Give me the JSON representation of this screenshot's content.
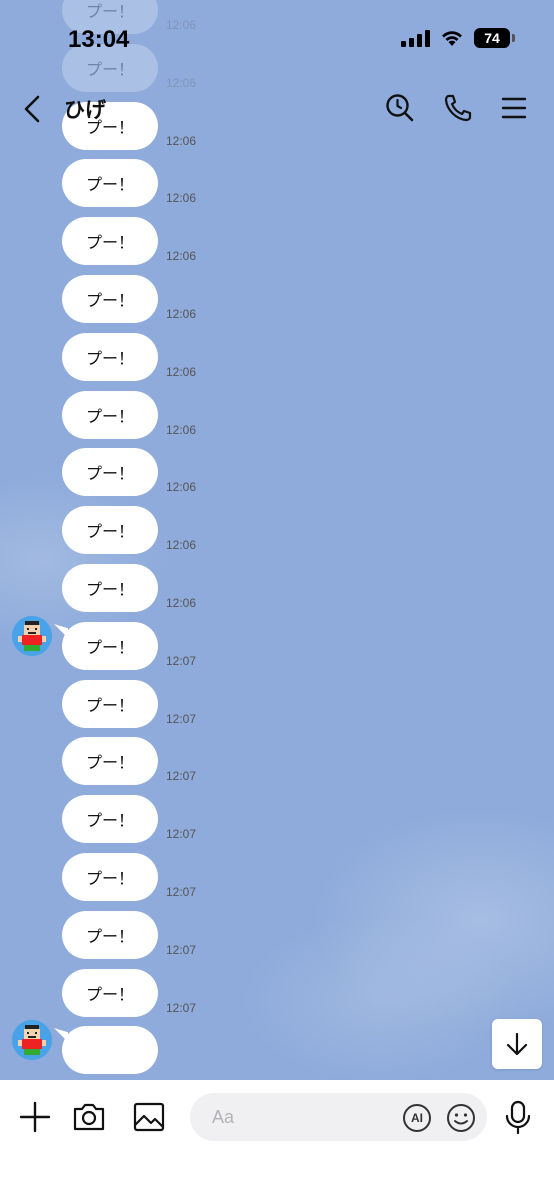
{
  "status_bar": {
    "time": "13:04",
    "battery": "74"
  },
  "header": {
    "title": "ひげ"
  },
  "messages": [
    {
      "text": "プー！",
      "time": "12:06",
      "faded": true
    },
    {
      "text": "プー！",
      "time": "12:06",
      "faded": true
    },
    {
      "text": "プー！",
      "time": "12:06"
    },
    {
      "text": "プー！",
      "time": "12:06"
    },
    {
      "text": "プー！",
      "time": "12:06"
    },
    {
      "text": "プー！",
      "time": "12:06"
    },
    {
      "text": "プー！",
      "time": "12:06"
    },
    {
      "text": "プー！",
      "time": "12:06"
    },
    {
      "text": "プー！",
      "time": "12:06"
    },
    {
      "text": "プー！",
      "time": "12:06"
    },
    {
      "text": "プー！",
      "time": "12:06"
    },
    {
      "text": "プー！",
      "time": "12:07",
      "avatar": true
    },
    {
      "text": "プー！",
      "time": "12:07"
    },
    {
      "text": "プー！",
      "time": "12:07"
    },
    {
      "text": "プー！",
      "time": "12:07"
    },
    {
      "text": "プー！",
      "time": "12:07"
    },
    {
      "text": "プー！",
      "time": "12:07"
    },
    {
      "text": "プー！",
      "time": "12:07"
    },
    {
      "text": "",
      "time": "",
      "avatar": true,
      "partial": true
    }
  ],
  "input": {
    "placeholder": "Aa",
    "ai_label": "AI"
  },
  "icons": {
    "back": "chevron-left-icon",
    "search": "search-clock-icon",
    "call": "phone-icon",
    "menu": "menu-icon",
    "plus": "plus-icon",
    "camera": "camera-icon",
    "image": "image-icon",
    "emoji": "emoji-icon",
    "mic": "microphone-icon",
    "scroll_down": "arrow-down-icon"
  }
}
